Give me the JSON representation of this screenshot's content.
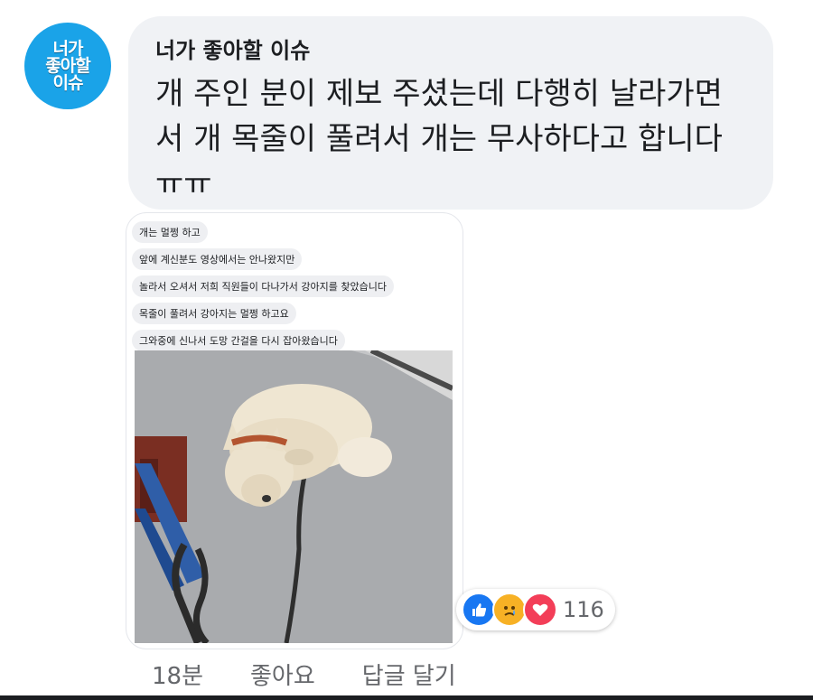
{
  "avatar": {
    "lines": [
      "너가",
      "좋아할",
      "이슈"
    ]
  },
  "comment": {
    "author": "너가 좋아할 이슈",
    "text_lines": [
      "개 주인 분이 제보 주셨는데 다행히 날라가면",
      "서 개 목줄이 풀려서 개는 무사하다고 합니다",
      "ㅠㅠ"
    ]
  },
  "attachment": {
    "messages": [
      "개는 멀쩡 하고",
      "앞에 계신분도 영상에서는 안나왔지만",
      "놀라서 오셔서 저희 직원들이 다나가서 강아지를 찾았습니다",
      "목줄이 풀려서 강아지는 멀쩡 하고요",
      "그와중에 신나서 도망 간걸을 다시 잡아왔습니다"
    ]
  },
  "reactions": {
    "icons": [
      "like-icon",
      "sad-icon",
      "love-icon"
    ],
    "count": "116"
  },
  "footer": {
    "time": "18분",
    "like": "좋아요",
    "reply": "답글 달기"
  },
  "colors": {
    "avatar_bg": "#1aa3e8",
    "bubble_bg": "#f0f2f5",
    "like": "#1877f2",
    "love": "#f33e58",
    "sad": "#f7b125"
  }
}
